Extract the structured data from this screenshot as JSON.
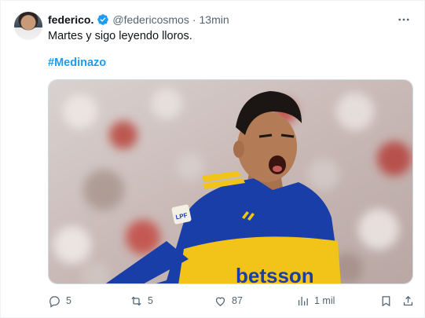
{
  "author": {
    "display_name": "federico.",
    "handle": "@federicosmos",
    "separator": "·",
    "time": "13min"
  },
  "tweet": {
    "text": "Martes y sigo leyendo lloros.",
    "hashtag": "#Medinazo"
  },
  "media": {
    "sponsor": "betsson",
    "badge": "LPF"
  },
  "actions": {
    "replies": "5",
    "retweets": "5",
    "likes": "87",
    "views": "1 mil"
  },
  "colors": {
    "accent": "#1d9bf0",
    "muted": "#536471",
    "jersey_blue": "#1a3ea8",
    "jersey_yellow": "#f2c318"
  },
  "icons": {
    "verified": "verified-badge-icon",
    "more": "more-dots-icon",
    "reply": "reply-icon",
    "retweet": "retweet-icon",
    "like": "heart-icon",
    "views": "views-icon",
    "bookmark": "bookmark-icon",
    "share": "share-icon"
  }
}
